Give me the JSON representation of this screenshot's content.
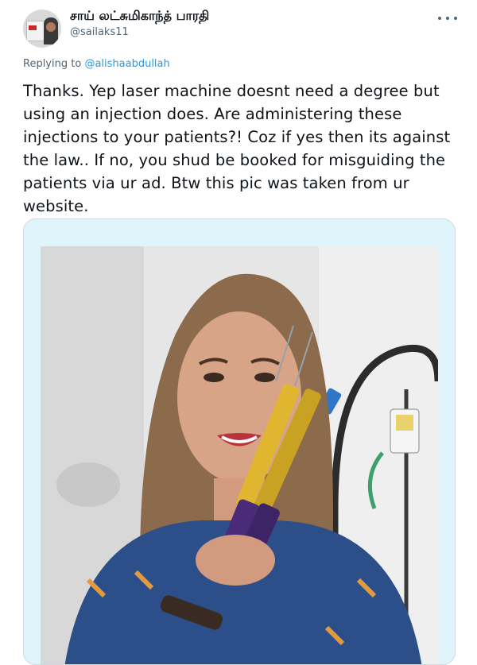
{
  "author": {
    "display_name": "சாய் லட்சுமிகாந்த் பாரதி",
    "handle": "@sailaks11"
  },
  "reply": {
    "prefix": "Replying to ",
    "mention": "@alishaabdullah"
  },
  "tweet": {
    "text": "Thanks. Yep laser machine doesnt need a degree but using an injection does. Are administering these injections to your patients?! Coz if yes then its against the law.. If no, you shud be booked for misguiding the patients via ur ad. Btw this pic was taken from ur website."
  },
  "icons": {
    "more": "more-horizontal-icon",
    "avatar": "avatar-image"
  },
  "colors": {
    "text": "#0f1419",
    "secondary": "#536471",
    "link": "#1d9bf0",
    "card_bg": "#dff4fb",
    "border": "#cfd9de"
  }
}
